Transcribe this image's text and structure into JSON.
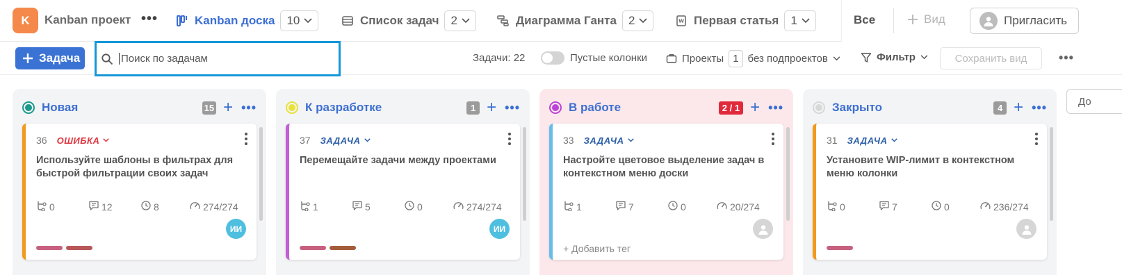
{
  "header": {
    "project_initial": "K",
    "project_name": "Kanban проект",
    "more_glyph": "•••",
    "tabs": [
      {
        "label": "Kanban доска",
        "count": "10",
        "active": true,
        "icon": "board-icon"
      },
      {
        "label": "Список задач",
        "count": "2",
        "active": false,
        "icon": "list-icon"
      },
      {
        "label": "Диаграмма Ганта",
        "count": "2",
        "active": false,
        "icon": "gantt-icon"
      },
      {
        "label": "Первая статья",
        "count": "1",
        "active": false,
        "icon": "document-icon"
      }
    ],
    "all_label": "Все",
    "add_view_label": "Вид",
    "invite_label": "Пригласить"
  },
  "toolbar": {
    "add_task_label": "Задача",
    "search_placeholder": "Поиск по задачам",
    "tasks_count": "Задачи: 22",
    "empty_columns_label": "Пустые колонки",
    "projects_label": "Проекты",
    "projects_count": "1",
    "subprojects_label": "без подпроектов",
    "filter_label": "Фильтр",
    "save_view_label": "Сохранить вид",
    "more_glyph": "•••"
  },
  "colors": {
    "accent": "#3b73d5",
    "search_focus": "#1597d8",
    "wip_exceeded": "#e02a3c"
  },
  "columns": [
    {
      "title": "Новая",
      "count": "15",
      "status_color": "#1a9a8a",
      "wip": false,
      "card": {
        "id": "36",
        "type": "ОШИБКА",
        "type_color": "#e0363f",
        "border_color": "#f29a1c",
        "title": "Используйте шаблоны в фильтрах для быстрой фильтрации своих задач",
        "subtasks": "0",
        "comments": "12",
        "time": "8",
        "progress": "274/274",
        "assignee": "ИИ",
        "assignee_color": "#4fbfe0",
        "tags": [
          "#c7617f",
          "#b85757"
        ]
      }
    },
    {
      "title": "К разработке",
      "count": "1",
      "status_color": "#e8e23a",
      "wip": false,
      "card": {
        "id": "37",
        "type": "ЗАДАЧА",
        "type_color": "#2d5fa8",
        "border_color": "#c35ed6",
        "title": "Перемещайте задачи между проектами",
        "subtasks": "1",
        "comments": "5",
        "time": "0",
        "progress": "274/274",
        "assignee": "ИИ",
        "assignee_color": "#4fbfe0",
        "tags": [
          "#c7617f",
          "#a35c3c"
        ]
      }
    },
    {
      "title": "В работе",
      "count": "2 / 1",
      "status_color": "#bb44d6",
      "wip": true,
      "card": {
        "id": "33",
        "type": "ЗАДАЧА",
        "type_color": "#2d5fa8",
        "border_color": "#66bcea",
        "title": "Настройте цветовое выделение задач в контекстном меню доски",
        "subtasks": "1",
        "comments": "7",
        "time": "0",
        "progress": "20/274",
        "assignee": "",
        "add_tag_label": "+ Добавить тег"
      }
    },
    {
      "title": "Закрыто",
      "count": "4",
      "status_color": "#d8d8d8",
      "wip": false,
      "card": {
        "id": "31",
        "type": "ЗАДАЧА",
        "type_color": "#2d5fa8",
        "border_color": "#f29a1c",
        "title": "Установите WIP-лимит в контекстном меню колонки",
        "subtasks": "0",
        "comments": "7",
        "time": "0",
        "progress": "236/274",
        "assignee": "",
        "tags": [
          "#c7617f"
        ]
      }
    }
  ],
  "cut_button_label": "До"
}
